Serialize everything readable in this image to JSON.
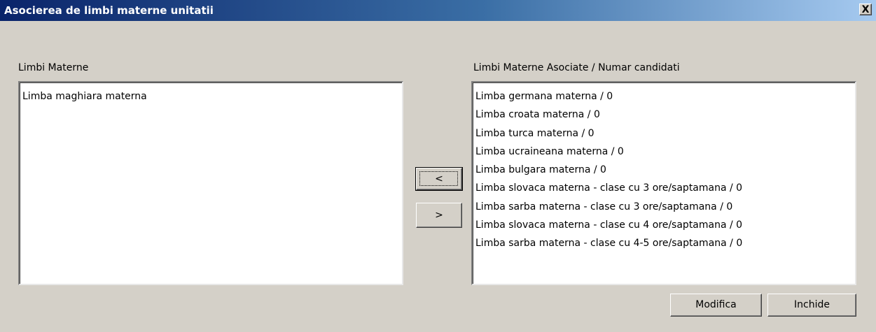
{
  "window": {
    "title": "Asocierea de limbi materne unitatii",
    "close_label": "X"
  },
  "left": {
    "label": "Limbi Materne",
    "items": [
      "Limba maghiara materna"
    ]
  },
  "right": {
    "label": "Limbi Materne Asociate / Numar candidati",
    "items": [
      "Limba germana materna / 0",
      "Limba croata materna / 0",
      "Limba turca materna / 0",
      "Limba ucraineana materna / 0",
      "Limba bulgara materna / 0",
      "Limba slovaca materna - clase cu 3 ore/saptamana / 0",
      "Limba sarba materna - clase cu 3 ore/saptamana / 0",
      "Limba slovaca materna - clase cu 4 ore/saptamana / 0",
      "Limba sarba materna - clase cu 4-5 ore/saptamana / 0"
    ]
  },
  "buttons": {
    "move_left": "<",
    "move_right": ">",
    "modify": "Modifica",
    "close": "Inchide"
  }
}
